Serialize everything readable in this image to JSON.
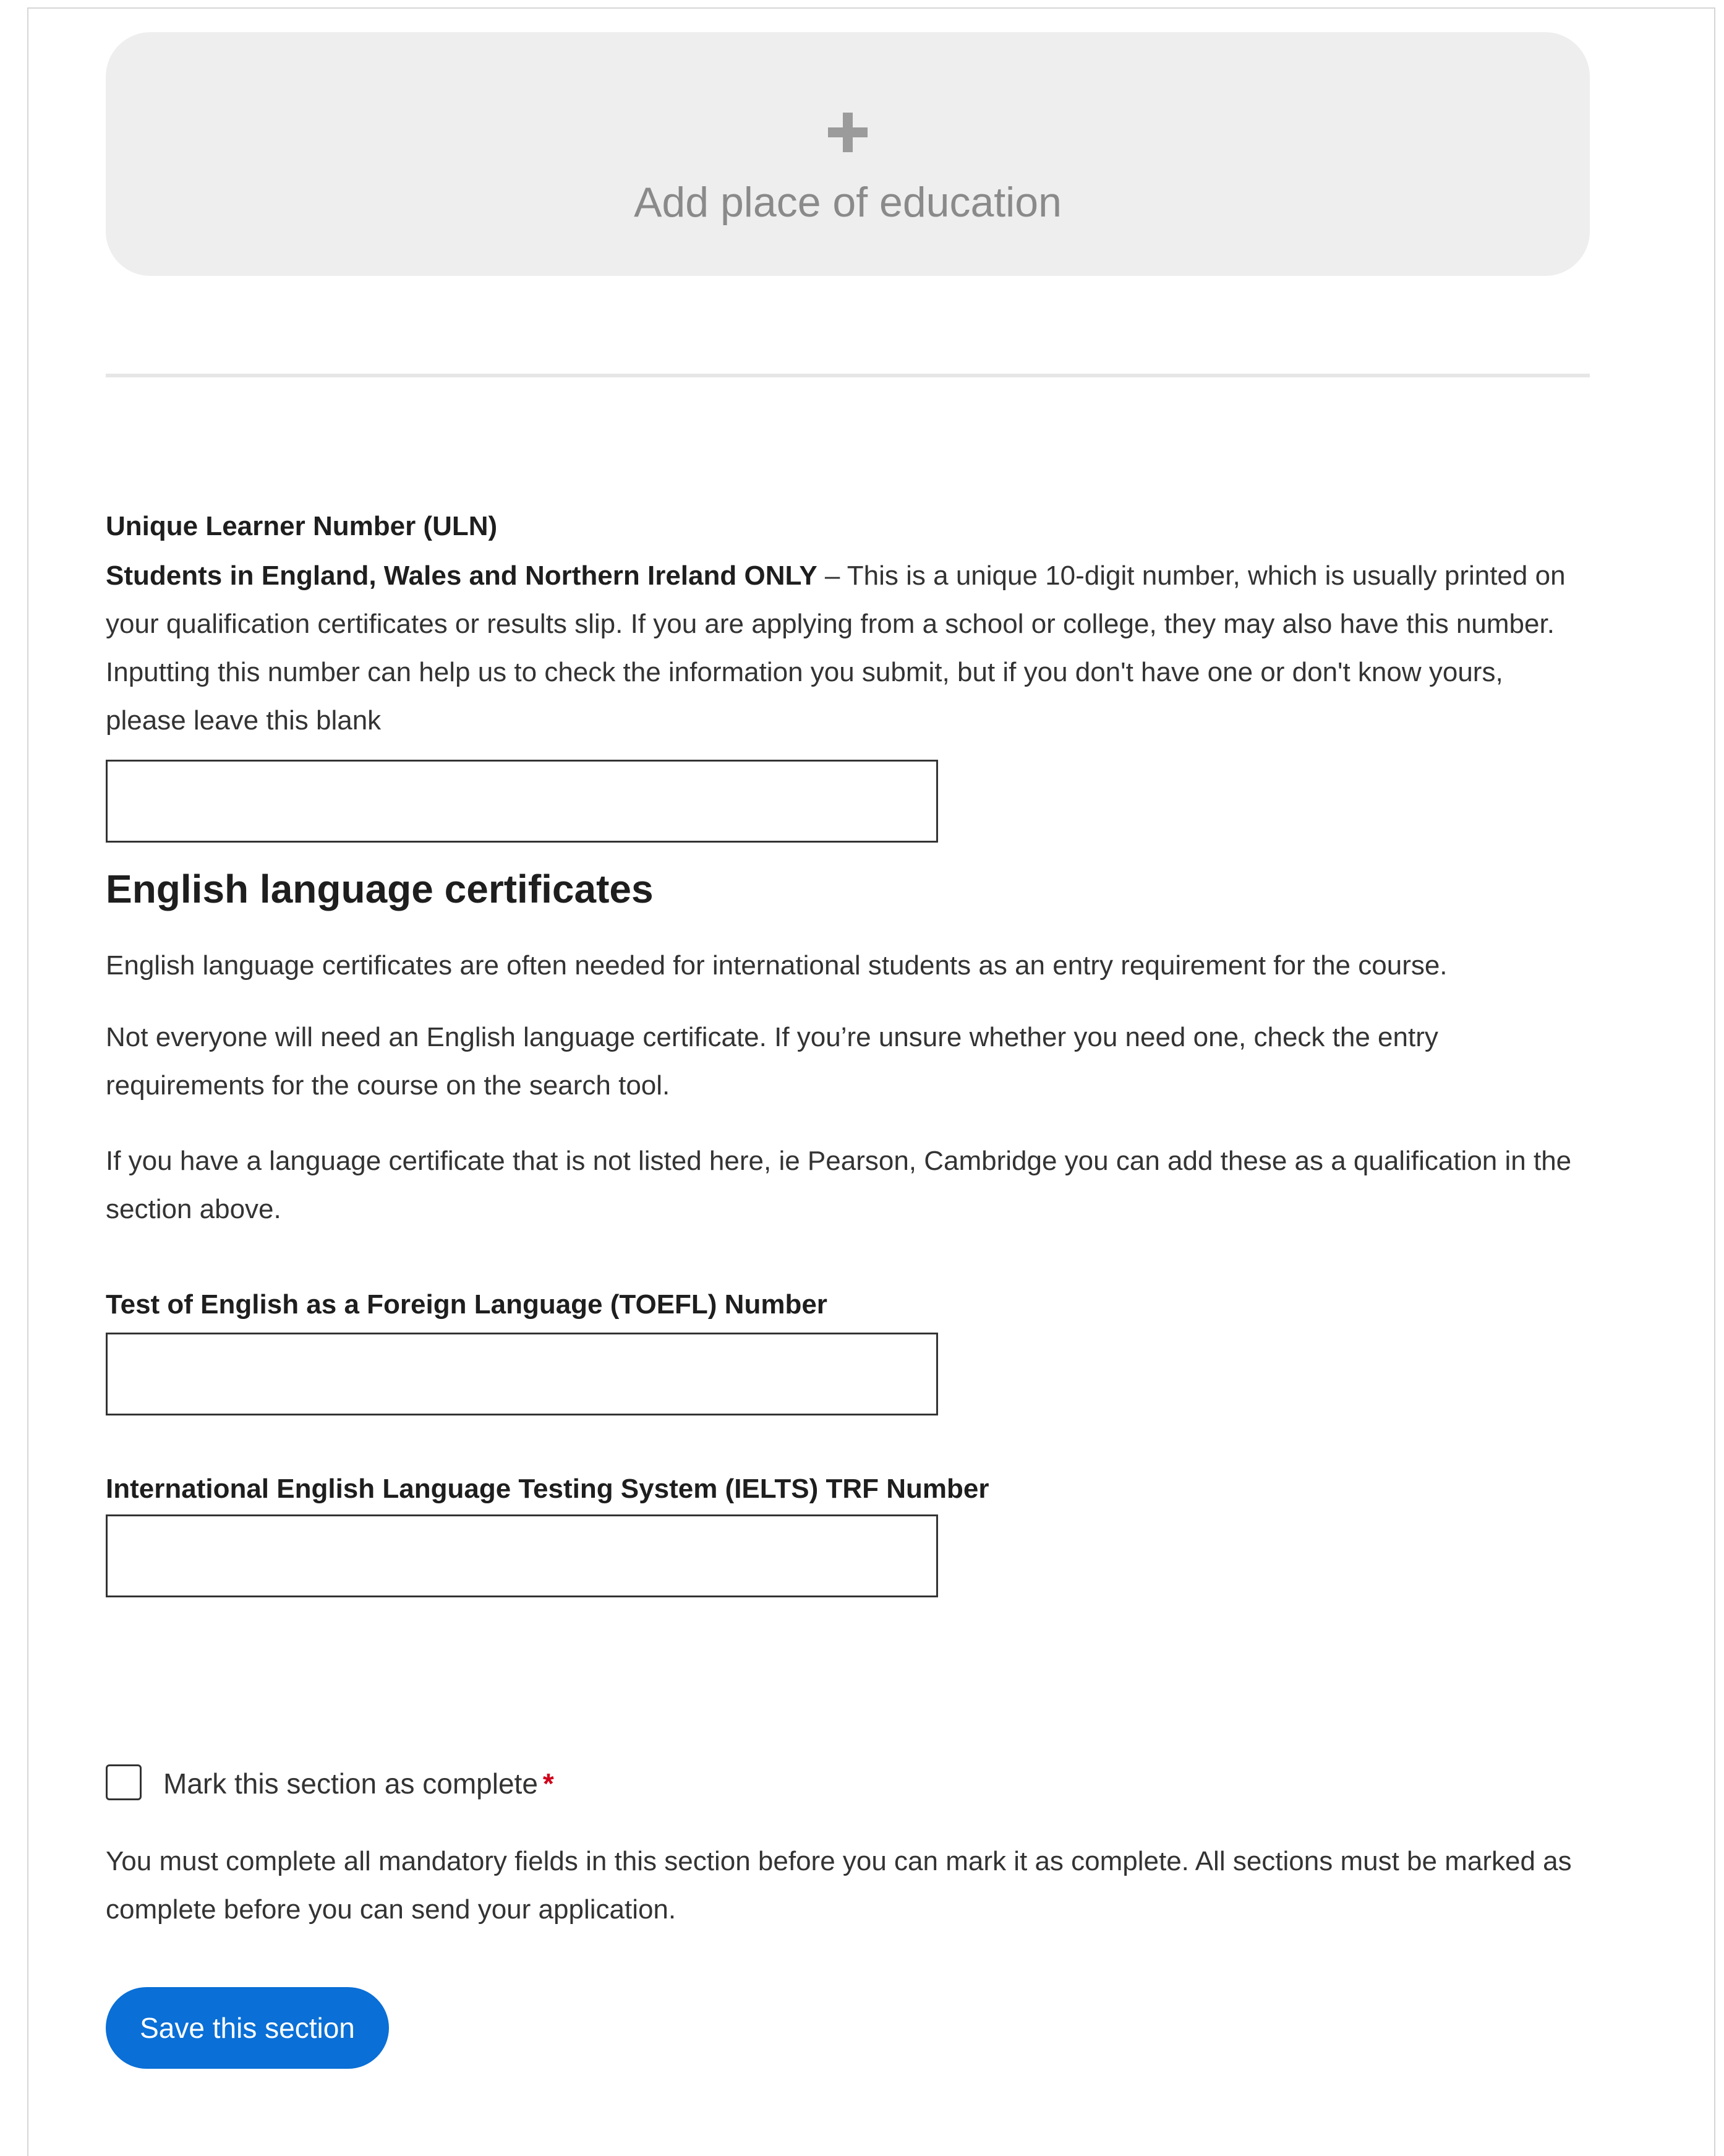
{
  "education": {
    "add_label": "Add place of education"
  },
  "uln": {
    "label": "Unique Learner Number (ULN)",
    "notice_bold": "Students in England, Wales and Northern Ireland ONLY",
    "notice_text": " – This is a unique 10-digit number, which is usually printed on your qualification certificates or results slip. If you are applying from a school or college, they may also have this number. Inputting this number can help us to check the information you submit, but if you don't have one or don't know yours, please leave this blank",
    "value": ""
  },
  "english": {
    "heading": "English language certificates",
    "para1": "English language certificates are often needed for international students as an entry requirement for the course.",
    "para2": "Not everyone will need an English language certificate. If you’re unsure whether you need one, check the entry requirements for the course on the search tool.",
    "para3": "If you have a language certificate that is not listed here, ie Pearson, Cambridge you can add these as a qualification in the section above.",
    "toefl_label": "Test of English as a Foreign Language (TOEFL) Number",
    "toefl_value": "",
    "ielts_label": "International English Language Testing System (IELTS) TRF Number",
    "ielts_value": ""
  },
  "completion": {
    "checkbox_label": "Mark this section as complete",
    "required_mark": "*",
    "checked": false,
    "note": "You must complete all mandatory fields in this section before you can mark it as complete. All sections must be marked as complete before you can send your application."
  },
  "actions": {
    "save_label": "Save this section"
  },
  "colors": {
    "primary": "#0a6fd6",
    "required": "#d0021b",
    "panel": "#eeeeee"
  }
}
